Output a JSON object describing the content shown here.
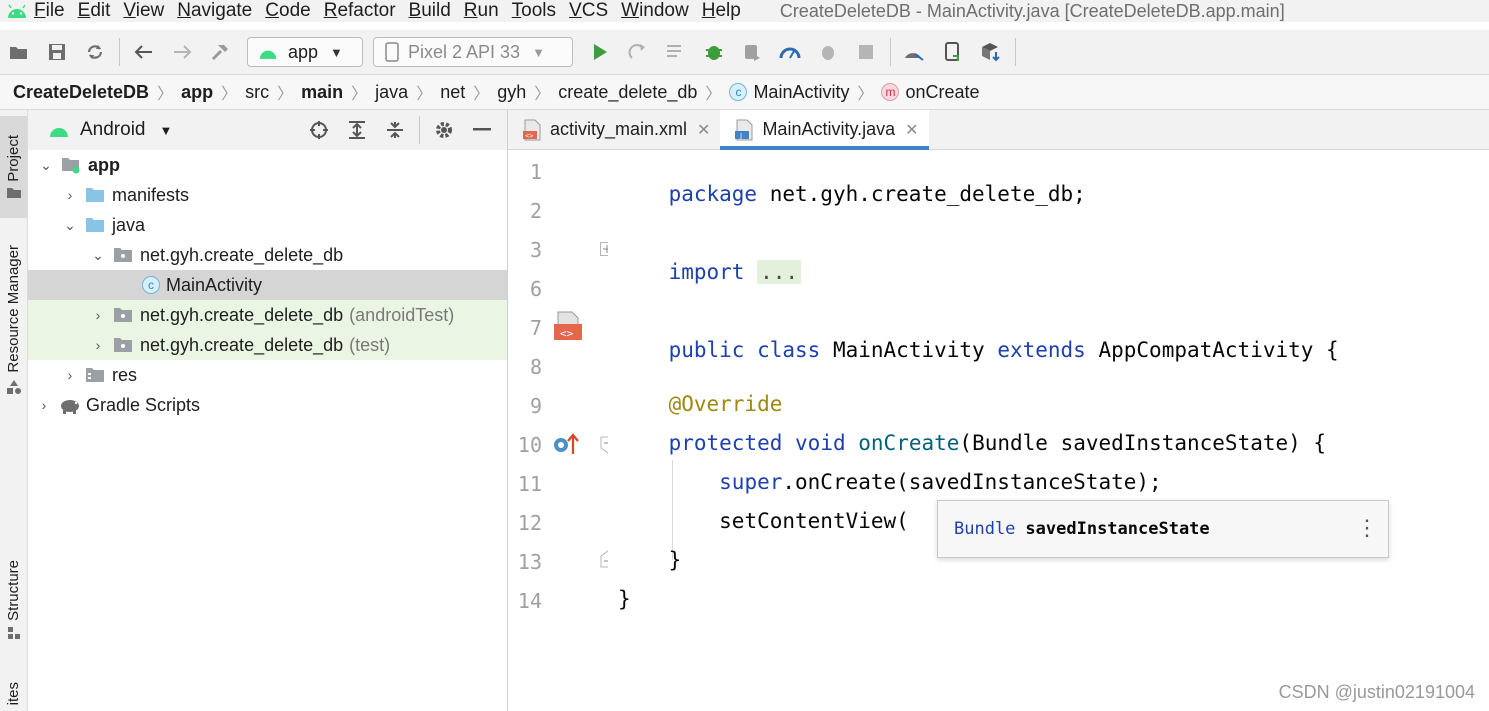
{
  "menu": {
    "items": [
      "File",
      "Edit",
      "View",
      "Navigate",
      "Code",
      "Refactor",
      "Build",
      "Run",
      "Tools",
      "VCS",
      "Window",
      "Help"
    ],
    "window_title": "CreateDeleteDB - MainActivity.java [CreateDeleteDB.app.main]"
  },
  "toolbar": {
    "config_label": "app",
    "device_label": "Pixel 2 API 33"
  },
  "breadcrumbs": [
    "CreateDeleteDB",
    "app",
    "src",
    "main",
    "java",
    "net",
    "gyh",
    "create_delete_db",
    "MainActivity",
    "onCreate"
  ],
  "project_panel": {
    "view_label": "Android",
    "tree": {
      "app": "app",
      "manifests": "manifests",
      "java": "java",
      "pkg_main": "net.gyh.create_delete_db",
      "main_activity": "MainActivity",
      "pkg_android_test": "net.gyh.create_delete_db",
      "android_test_suffix": "(androidTest)",
      "pkg_test": "net.gyh.create_delete_db",
      "test_suffix": "(test)",
      "res": "res",
      "gradle": "Gradle Scripts"
    }
  },
  "side_tabs": {
    "project": "Project",
    "resource_manager": "Resource Manager",
    "structure": "Structure",
    "favorites_partial": "ites"
  },
  "editor": {
    "tabs": [
      {
        "label": "activity_main.xml",
        "active": false
      },
      {
        "label": "MainActivity.java",
        "active": true
      }
    ],
    "line_numbers": [
      "1",
      "2",
      "3",
      "6",
      "7",
      "8",
      "9",
      "10",
      "11",
      "12",
      "13",
      "14"
    ],
    "code": {
      "l1_kw": "package",
      "l1_rest": " net.gyh.create_delete_db;",
      "l3_kw": "import",
      "l3_fold": "...",
      "l7_kw1": "public",
      "l7_kw2": "class",
      "l7_name": " MainActivity ",
      "l7_kw3": "extends",
      "l7_rest": " AppCompatActivity {",
      "l9_ann": "@Override",
      "l10_kw1": "protected",
      "l10_kw2": "void",
      "l10_fn": "onCreate",
      "l10_rest": "(Bundle savedInstanceState) {",
      "l11_kw": "super",
      "l11_rest": ".onCreate(savedInstanceState);",
      "l12_text": "setContentView(",
      "l13_text": "}",
      "l14_text": "}"
    },
    "popup": {
      "type": "Bundle",
      "name": "savedInstanceState"
    }
  },
  "watermark": "CSDN @justin02191004",
  "colors": {
    "keyword": "#1d3fb0",
    "annotation": "#9e880d",
    "method": "#00627a",
    "android_green": "#3ddc84",
    "run_green": "#3c9d3c",
    "selection": "#d5d5d5",
    "test_bg": "#eaf6e3",
    "tab_underline": "#4083c9"
  }
}
